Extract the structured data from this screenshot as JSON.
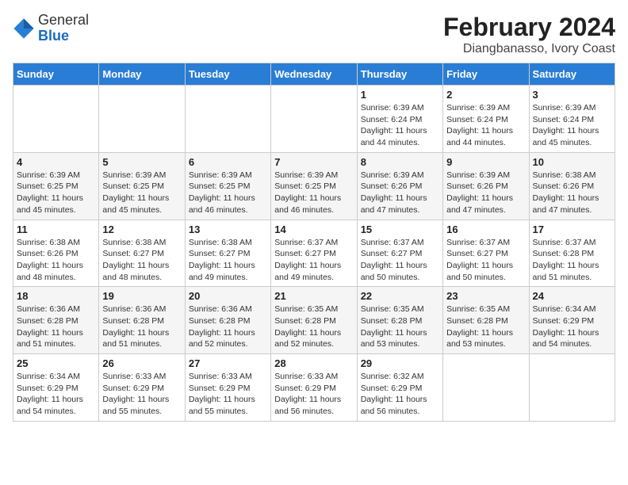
{
  "header": {
    "logo_general": "General",
    "logo_blue": "Blue",
    "title": "February 2024",
    "subtitle": "Diangbanasso, Ivory Coast"
  },
  "weekdays": [
    "Sunday",
    "Monday",
    "Tuesday",
    "Wednesday",
    "Thursday",
    "Friday",
    "Saturday"
  ],
  "weeks": [
    [
      {
        "day": "",
        "info": ""
      },
      {
        "day": "",
        "info": ""
      },
      {
        "day": "",
        "info": ""
      },
      {
        "day": "",
        "info": ""
      },
      {
        "day": "1",
        "info": "Sunrise: 6:39 AM\nSunset: 6:24 PM\nDaylight: 11 hours\nand 44 minutes."
      },
      {
        "day": "2",
        "info": "Sunrise: 6:39 AM\nSunset: 6:24 PM\nDaylight: 11 hours\nand 44 minutes."
      },
      {
        "day": "3",
        "info": "Sunrise: 6:39 AM\nSunset: 6:24 PM\nDaylight: 11 hours\nand 45 minutes."
      }
    ],
    [
      {
        "day": "4",
        "info": "Sunrise: 6:39 AM\nSunset: 6:25 PM\nDaylight: 11 hours\nand 45 minutes."
      },
      {
        "day": "5",
        "info": "Sunrise: 6:39 AM\nSunset: 6:25 PM\nDaylight: 11 hours\nand 45 minutes."
      },
      {
        "day": "6",
        "info": "Sunrise: 6:39 AM\nSunset: 6:25 PM\nDaylight: 11 hours\nand 46 minutes."
      },
      {
        "day": "7",
        "info": "Sunrise: 6:39 AM\nSunset: 6:25 PM\nDaylight: 11 hours\nand 46 minutes."
      },
      {
        "day": "8",
        "info": "Sunrise: 6:39 AM\nSunset: 6:26 PM\nDaylight: 11 hours\nand 47 minutes."
      },
      {
        "day": "9",
        "info": "Sunrise: 6:39 AM\nSunset: 6:26 PM\nDaylight: 11 hours\nand 47 minutes."
      },
      {
        "day": "10",
        "info": "Sunrise: 6:38 AM\nSunset: 6:26 PM\nDaylight: 11 hours\nand 47 minutes."
      }
    ],
    [
      {
        "day": "11",
        "info": "Sunrise: 6:38 AM\nSunset: 6:26 PM\nDaylight: 11 hours\nand 48 minutes."
      },
      {
        "day": "12",
        "info": "Sunrise: 6:38 AM\nSunset: 6:27 PM\nDaylight: 11 hours\nand 48 minutes."
      },
      {
        "day": "13",
        "info": "Sunrise: 6:38 AM\nSunset: 6:27 PM\nDaylight: 11 hours\nand 49 minutes."
      },
      {
        "day": "14",
        "info": "Sunrise: 6:37 AM\nSunset: 6:27 PM\nDaylight: 11 hours\nand 49 minutes."
      },
      {
        "day": "15",
        "info": "Sunrise: 6:37 AM\nSunset: 6:27 PM\nDaylight: 11 hours\nand 50 minutes."
      },
      {
        "day": "16",
        "info": "Sunrise: 6:37 AM\nSunset: 6:27 PM\nDaylight: 11 hours\nand 50 minutes."
      },
      {
        "day": "17",
        "info": "Sunrise: 6:37 AM\nSunset: 6:28 PM\nDaylight: 11 hours\nand 51 minutes."
      }
    ],
    [
      {
        "day": "18",
        "info": "Sunrise: 6:36 AM\nSunset: 6:28 PM\nDaylight: 11 hours\nand 51 minutes."
      },
      {
        "day": "19",
        "info": "Sunrise: 6:36 AM\nSunset: 6:28 PM\nDaylight: 11 hours\nand 51 minutes."
      },
      {
        "day": "20",
        "info": "Sunrise: 6:36 AM\nSunset: 6:28 PM\nDaylight: 11 hours\nand 52 minutes."
      },
      {
        "day": "21",
        "info": "Sunrise: 6:35 AM\nSunset: 6:28 PM\nDaylight: 11 hours\nand 52 minutes."
      },
      {
        "day": "22",
        "info": "Sunrise: 6:35 AM\nSunset: 6:28 PM\nDaylight: 11 hours\nand 53 minutes."
      },
      {
        "day": "23",
        "info": "Sunrise: 6:35 AM\nSunset: 6:28 PM\nDaylight: 11 hours\nand 53 minutes."
      },
      {
        "day": "24",
        "info": "Sunrise: 6:34 AM\nSunset: 6:29 PM\nDaylight: 11 hours\nand 54 minutes."
      }
    ],
    [
      {
        "day": "25",
        "info": "Sunrise: 6:34 AM\nSunset: 6:29 PM\nDaylight: 11 hours\nand 54 minutes."
      },
      {
        "day": "26",
        "info": "Sunrise: 6:33 AM\nSunset: 6:29 PM\nDaylight: 11 hours\nand 55 minutes."
      },
      {
        "day": "27",
        "info": "Sunrise: 6:33 AM\nSunset: 6:29 PM\nDaylight: 11 hours\nand 55 minutes."
      },
      {
        "day": "28",
        "info": "Sunrise: 6:33 AM\nSunset: 6:29 PM\nDaylight: 11 hours\nand 56 minutes."
      },
      {
        "day": "29",
        "info": "Sunrise: 6:32 AM\nSunset: 6:29 PM\nDaylight: 11 hours\nand 56 minutes."
      },
      {
        "day": "",
        "info": ""
      },
      {
        "day": "",
        "info": ""
      }
    ]
  ]
}
